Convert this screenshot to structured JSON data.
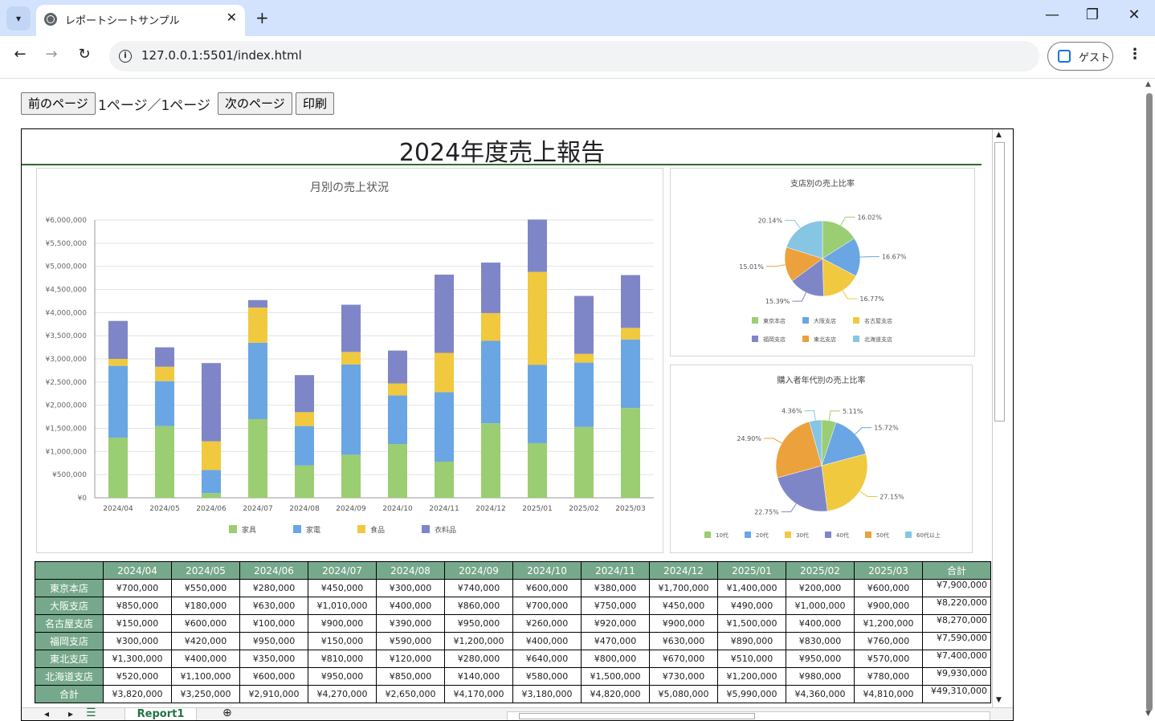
{
  "browser": {
    "tab_title": "レポートシートサンプル",
    "url": "127.0.0.1:5501/index.html",
    "profile_label": "ゲスト"
  },
  "controls": {
    "prev_label": "前のページ",
    "page_indicator": "1ページ／1ページ",
    "next_label": "次のページ",
    "print_label": "印刷"
  },
  "report": {
    "title": "2024年度売上報告",
    "sheet_tab": "Report1"
  },
  "colors": {
    "furniture": "#9bcd72",
    "appliance": "#6aa6e3",
    "food": "#f0c93f",
    "clothing": "#7f86c8",
    "orange": "#eba13c",
    "skyblue": "#86c5e4",
    "header_green": "#76a88b"
  },
  "chart_data": [
    {
      "type": "bar",
      "stacked": true,
      "title": "月別の売上状況",
      "categories": [
        "2024/04",
        "2024/05",
        "2024/06",
        "2024/07",
        "2024/08",
        "2024/09",
        "2024/10",
        "2024/11",
        "2024/12",
        "2025/01",
        "2025/02",
        "2025/03"
      ],
      "yticks": [
        "¥0",
        "¥500,000",
        "¥1,000,000",
        "¥1,500,000",
        "¥2,000,000",
        "¥2,500,000",
        "¥3,000,000",
        "¥3,500,000",
        "¥4,000,000",
        "¥4,500,000",
        "¥5,000,000",
        "¥5,500,000",
        "¥6,000,000"
      ],
      "ylim": [
        0,
        6000000
      ],
      "legend_position": "bottom",
      "series": [
        {
          "name": "家具",
          "color": "#9bcd72",
          "values": [
            1300000,
            1550000,
            100000,
            1700000,
            700000,
            930000,
            1160000,
            780000,
            1610000,
            1180000,
            1530000,
            1940000
          ]
        },
        {
          "name": "家電",
          "color": "#6aa6e3",
          "values": [
            1550000,
            970000,
            500000,
            1650000,
            850000,
            1950000,
            1050000,
            1500000,
            1780000,
            1690000,
            1390000,
            1480000
          ]
        },
        {
          "name": "食品",
          "color": "#f0c93f",
          "values": [
            150000,
            310000,
            620000,
            760000,
            300000,
            270000,
            260000,
            850000,
            600000,
            2010000,
            190000,
            250000
          ]
        },
        {
          "name": "衣料品",
          "color": "#7f86c8",
          "values": [
            820000,
            420000,
            1690000,
            160000,
            800000,
            1020000,
            710000,
            1690000,
            1090000,
            1130000,
            1250000,
            1140000
          ]
        }
      ]
    },
    {
      "type": "pie",
      "title": "支店別の売上比率",
      "legend_position": "bottom",
      "labels": [
        "東京本店",
        "大阪支店",
        "名古屋支店",
        "福岡支店",
        "東北支店",
        "北海道支店"
      ],
      "values": [
        16.02,
        16.67,
        16.77,
        15.39,
        15.01,
        20.14
      ],
      "value_labels": [
        "16.02%",
        "16.67%",
        "16.77%",
        "15.39%",
        "15.01%",
        "20.14%"
      ],
      "colors": [
        "#9bcd72",
        "#6aa6e3",
        "#f0c93f",
        "#7f86c8",
        "#eba13c",
        "#86c5e4"
      ]
    },
    {
      "type": "pie",
      "title": "購入者年代別の売上比率",
      "legend_position": "bottom",
      "labels": [
        "10代",
        "20代",
        "30代",
        "40代",
        "50代",
        "60代以上"
      ],
      "values": [
        5.11,
        15.72,
        27.15,
        22.75,
        24.9,
        4.36
      ],
      "value_labels": [
        "5.11%",
        "15.72%",
        "27.15%",
        "22.75%",
        "24.90%",
        "4.36%"
      ],
      "colors": [
        "#9bcd72",
        "#6aa6e3",
        "#f0c93f",
        "#7f86c8",
        "#eba13c",
        "#86c5e4"
      ]
    }
  ],
  "table": {
    "headers": [
      "2024/04",
      "2024/05",
      "2024/06",
      "2024/07",
      "2024/08",
      "2024/09",
      "2024/10",
      "2024/11",
      "2024/12",
      "2025/01",
      "2025/02",
      "2025/03",
      "合計"
    ],
    "rows": [
      {
        "label": "東京本店",
        "cells": [
          "¥700,000",
          "¥550,000",
          "¥280,000",
          "¥450,000",
          "¥300,000",
          "¥740,000",
          "¥600,000",
          "¥380,000",
          "¥1,700,000",
          "¥1,400,000",
          "¥200,000",
          "¥600,000",
          "¥7,900,000"
        ]
      },
      {
        "label": "大阪支店",
        "cells": [
          "¥850,000",
          "¥180,000",
          "¥630,000",
          "¥1,010,000",
          "¥400,000",
          "¥860,000",
          "¥700,000",
          "¥750,000",
          "¥450,000",
          "¥490,000",
          "¥1,000,000",
          "¥900,000",
          "¥8,220,000"
        ]
      },
      {
        "label": "名古屋支店",
        "cells": [
          "¥150,000",
          "¥600,000",
          "¥100,000",
          "¥900,000",
          "¥390,000",
          "¥950,000",
          "¥260,000",
          "¥920,000",
          "¥900,000",
          "¥1,500,000",
          "¥400,000",
          "¥1,200,000",
          "¥8,270,000"
        ]
      },
      {
        "label": "福岡支店",
        "cells": [
          "¥300,000",
          "¥420,000",
          "¥950,000",
          "¥150,000",
          "¥590,000",
          "¥1,200,000",
          "¥400,000",
          "¥470,000",
          "¥630,000",
          "¥890,000",
          "¥830,000",
          "¥760,000",
          "¥7,590,000"
        ]
      },
      {
        "label": "東北支店",
        "cells": [
          "¥1,300,000",
          "¥400,000",
          "¥350,000",
          "¥810,000",
          "¥120,000",
          "¥280,000",
          "¥640,000",
          "¥800,000",
          "¥670,000",
          "¥510,000",
          "¥950,000",
          "¥570,000",
          "¥7,400,000"
        ]
      },
      {
        "label": "北海道支店",
        "cells": [
          "¥520,000",
          "¥1,100,000",
          "¥600,000",
          "¥950,000",
          "¥850,000",
          "¥140,000",
          "¥580,000",
          "¥1,500,000",
          "¥730,000",
          "¥1,200,000",
          "¥980,000",
          "¥780,000",
          "¥9,930,000"
        ]
      },
      {
        "label": "合計",
        "cells": [
          "¥3,820,000",
          "¥3,250,000",
          "¥2,910,000",
          "¥4,270,000",
          "¥2,650,000",
          "¥4,170,000",
          "¥3,180,000",
          "¥4,820,000",
          "¥5,080,000",
          "¥5,990,000",
          "¥4,360,000",
          "¥4,810,000",
          "¥49,310,000"
        ]
      }
    ]
  }
}
